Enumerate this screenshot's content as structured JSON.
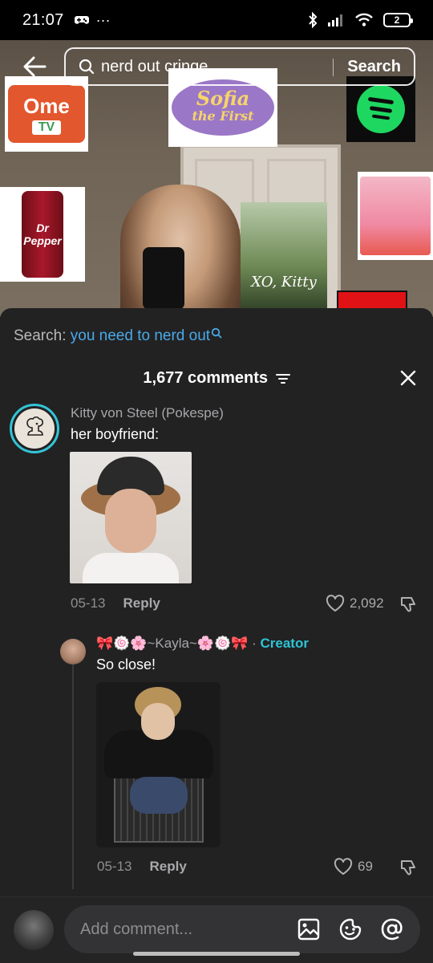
{
  "status_bar": {
    "time": "21:07",
    "extra": "···",
    "battery": "2"
  },
  "search": {
    "query": "nerd out cringe",
    "button": "Search"
  },
  "video": {
    "stickers": {
      "ome_top": "Ome",
      "ome_bottom": "TV",
      "sofia_line1": "Sofia",
      "sofia_line2": "the First",
      "pepper": "Dr Pepper",
      "kitty": "XO, Kitty"
    }
  },
  "comments_sheet": {
    "search_prefix": "Search:",
    "search_term": "you need to nerd out",
    "title": "1,677 comments"
  },
  "comment": {
    "username": "Kitty von Steel (Pokespe)",
    "text": "her boyfriend:",
    "date": "05-13",
    "reply": "Reply",
    "likes": "2,092"
  },
  "reply_comment": {
    "username": "🎀🍥🌸~Kayla~🌸🍥🎀",
    "separator": " · ",
    "badge": "Creator",
    "text": "So close!",
    "date": "05-13",
    "reply": "Reply",
    "likes": "69"
  },
  "composer": {
    "placeholder": "Add comment..."
  },
  "colors": {
    "accent_blue": "#4aa9e8",
    "creator_teal": "#2ec4d4",
    "sheet_bg": "#222223"
  }
}
